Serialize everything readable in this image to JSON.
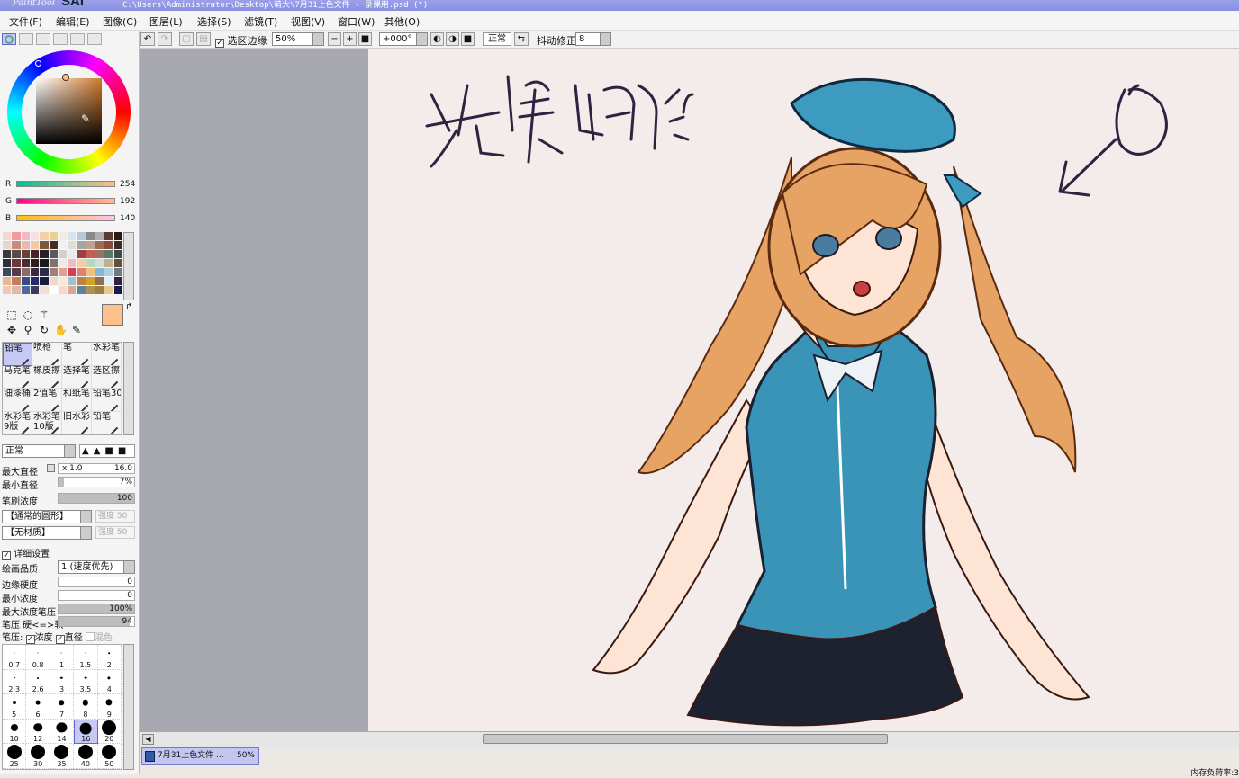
{
  "titlebar": {
    "logo_small": "PaintTool",
    "logo_big": "SAI",
    "path": "C:\\Users\\Administrator\\Desktop\\萌大\\7月31上色文件 - 录课用.psd (*)"
  },
  "menu": [
    "文件(F)",
    "编辑(E)",
    "图像(C)",
    "图层(L)",
    "选择(S)",
    "滤镜(T)",
    "视图(V)",
    "窗口(W)",
    "其他(O)"
  ],
  "toolbar": {
    "selection_edge_label": "选区边缘",
    "selection_edge_checked": true,
    "zoom": "50%",
    "rotation": "+000°",
    "blend": "正常",
    "stabilizer_label": "抖动修正",
    "stabilizer": "8"
  },
  "color": {
    "r": "254",
    "g": "192",
    "b": "140",
    "r_label": "R",
    "g_label": "G",
    "b_label": "B",
    "current": "#fec08c"
  },
  "tools": [
    {
      "l": "铅笔",
      "sel": true
    },
    {
      "l": "喷枪"
    },
    {
      "l": "笔"
    },
    {
      "l": "水彩笔"
    },
    {
      "l": "马克笔"
    },
    {
      "l": "橡皮擦"
    },
    {
      "l": "选择笔"
    },
    {
      "l": "选区擦"
    },
    {
      "l": "油漆桶"
    },
    {
      "l": "2值笔"
    },
    {
      "l": "和纸笔"
    },
    {
      "l": "铅笔30"
    },
    {
      "l": "水彩笔\n9版"
    },
    {
      "l": "水彩笔\n10版"
    },
    {
      "l": "旧水彩"
    },
    {
      "l": "铅笔"
    }
  ],
  "brush": {
    "mode": "正常",
    "max_size_label": "最大直径",
    "max_size_mult": "x 1.0",
    "max_size": "16.0",
    "min_size_label": "最小直径",
    "min_size": "7%",
    "min_size_frac": 0.07,
    "density_label": "笔刷浓度",
    "density": "100",
    "density_frac": 1.0,
    "shape": "【通常的圆形】",
    "shape_strength": "强度 50",
    "texture": "【无材质】",
    "texture_strength": "强度 50",
    "advanced_label": "详细设置",
    "advanced_checked": true,
    "quality_label": "绘画品质",
    "quality": "1 (速度优先)",
    "edge_label": "边缘硬度",
    "edge": "0",
    "min_density_label": "最小浓度",
    "min_density": "0",
    "max_pressure_label": "最大浓度笔压",
    "max_pressure": "100%",
    "pressure_label": "笔压 硬<=>软",
    "pressure": "94",
    "pressure_frac": 0.94,
    "pressure_opts_label": "笔压:",
    "opt_density": "浓度",
    "opt_size": "直径",
    "opt_blend": "混色"
  },
  "brush_sizes": [
    "0.7",
    "0.8",
    "1",
    "1.5",
    "2",
    "2.3",
    "2.6",
    "3",
    "3.5",
    "4",
    "5",
    "6",
    "7",
    "8",
    "9",
    "10",
    "12",
    "14",
    "16",
    "20",
    "25",
    "30",
    "35",
    "40",
    "50"
  ],
  "brush_selected": "16",
  "canvas": {
    "handwriting": "先调确定"
  },
  "document": {
    "tab_name": "7月31上色文件 ...",
    "tab_zoom": "50%"
  },
  "status": {
    "memory": "内存负荷率:3"
  },
  "colors": {
    "hair": "#e7a364",
    "hat": "#3d9bbf",
    "top": "#3a94b8",
    "skirt": "#1c2230",
    "skin": "#fde4d4",
    "ink": "#2e2340",
    "bg": "#f4ecea"
  }
}
